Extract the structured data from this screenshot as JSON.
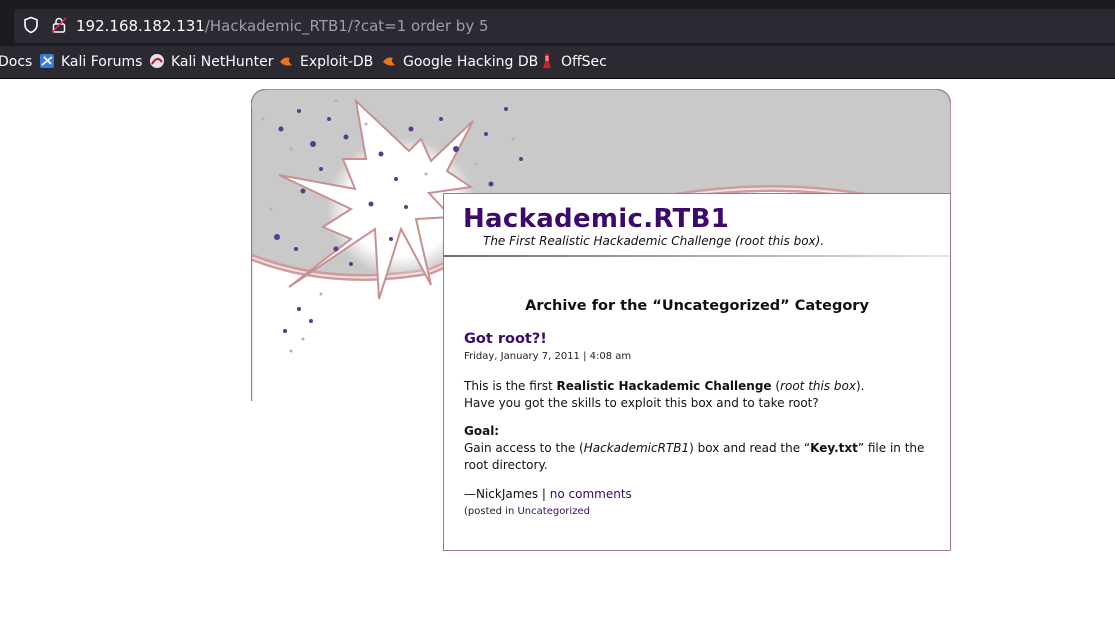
{
  "browser": {
    "url_host": "192.168.182.131",
    "url_path": "/Hackademic_RTB1/?cat=1 order by 5",
    "bookmarks": [
      {
        "label": "Docs",
        "icon": "none"
      },
      {
        "label": "Kali Forums",
        "icon": "kali-forums-icon"
      },
      {
        "label": "Kali NetHunter",
        "icon": "kali-nethunter-icon"
      },
      {
        "label": "Exploit-DB",
        "icon": "exploit-db-icon"
      },
      {
        "label": "Google Hacking DB",
        "icon": "google-hacking-db-icon"
      },
      {
        "label": "OffSec",
        "icon": "offsec-icon"
      }
    ]
  },
  "site": {
    "title": "Hackademic.RTB1",
    "description": "The First Realistic Hackademic Challenge (root this box)."
  },
  "archive_heading": "Archive for the “Uncategorized” Category",
  "post": {
    "title": "Got root?!",
    "date": "Friday, January 7, 2011 | 4:08 am",
    "p1_pre": "This is the first ",
    "p1_bold": "Realistic Hackademic Challenge",
    "p1_paren_open": " (",
    "p1_italic": "root this box",
    "p1_paren_close": ").",
    "p1_line2": "Have you got the skills to exploit this box and to take root?",
    "goal_label": "Goal:",
    "goal_pre": "Gain access to the (",
    "goal_italic": "HackademicRTB1",
    "goal_mid": ") box and read the “",
    "goal_bold": "Key.txt",
    "goal_post": "” file in the root directory.",
    "author": "—NickJames | ",
    "comments_link": "no comments",
    "posted_in_label": "(posted in ",
    "category_link": "Uncategorized"
  },
  "colors": {
    "title_purple": "#3b0a6b",
    "chrome_dark": "#1c1b22",
    "chrome_toolbar": "#2b2a33"
  }
}
